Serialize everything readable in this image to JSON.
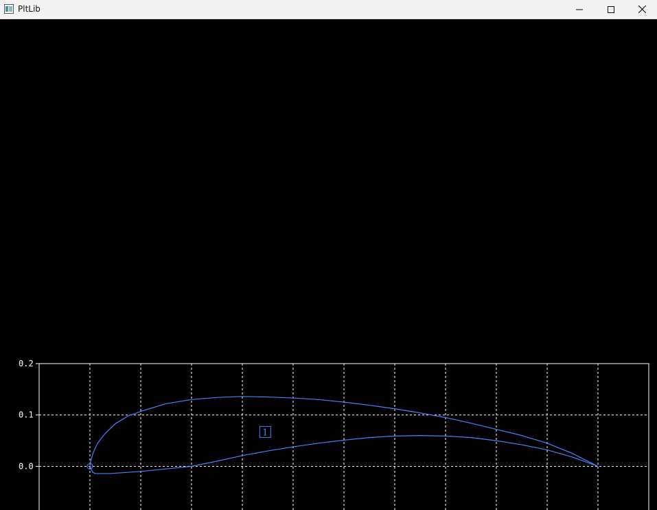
{
  "window": {
    "title": "PltLib",
    "minimize_icon": "minimize-icon",
    "maximize_icon": "maximize-icon",
    "close_icon": "close-icon"
  },
  "chart_data": {
    "type": "line",
    "grid": true,
    "background": "#000000",
    "axis_color": "#ffffff",
    "grid_color": "#ffffff",
    "line_color": "#4a80ff",
    "xlim": [
      -0.1,
      1.1
    ],
    "ylim": [
      -0.085,
      0.2
    ],
    "y_ticks": [
      0.0,
      0.1,
      0.2
    ],
    "y_tick_labels": [
      "0.0",
      "0.1",
      "0.2"
    ],
    "x_gridlines": [
      0.0,
      0.1,
      0.2,
      0.3,
      0.4,
      0.5,
      0.6,
      0.7,
      0.8,
      0.9,
      1.0
    ],
    "series": [
      {
        "x": [
          1.0,
          0.95,
          0.9,
          0.85,
          0.8,
          0.75,
          0.7,
          0.65,
          0.6,
          0.55,
          0.5,
          0.45,
          0.4,
          0.35,
          0.3,
          0.25,
          0.2,
          0.15,
          0.1,
          0.075,
          0.05,
          0.03,
          0.015,
          0.007,
          0.002,
          0.0
        ],
        "y": [
          0.0,
          0.025,
          0.045,
          0.06,
          0.072,
          0.084,
          0.095,
          0.104,
          0.112,
          0.119,
          0.125,
          0.13,
          0.133,
          0.135,
          0.136,
          0.134,
          0.13,
          0.122,
          0.107,
          0.098,
          0.083,
          0.064,
          0.045,
          0.028,
          0.012,
          0.0
        ]
      },
      {
        "x": [
          0.0,
          0.005,
          0.01,
          0.02,
          0.04,
          0.07,
          0.1,
          0.15,
          0.2,
          0.25,
          0.3,
          0.35,
          0.4,
          0.45,
          0.5,
          0.55,
          0.6,
          0.65,
          0.7,
          0.75,
          0.8,
          0.85,
          0.9,
          0.95,
          1.0
        ],
        "y": [
          0.0,
          -0.011,
          -0.014,
          -0.014,
          -0.014,
          -0.012,
          -0.01,
          -0.005,
          0.0,
          0.01,
          0.021,
          0.03,
          0.038,
          0.045,
          0.051,
          0.056,
          0.059,
          0.06,
          0.059,
          0.056,
          0.05,
          0.042,
          0.032,
          0.018,
          0.0
        ]
      }
    ],
    "marker": {
      "shape": "circle",
      "x": 0.0,
      "y": 0.0
    },
    "annotations": [
      {
        "text": "1",
        "x": 0.345,
        "y": 0.067,
        "boxed": true
      }
    ]
  }
}
